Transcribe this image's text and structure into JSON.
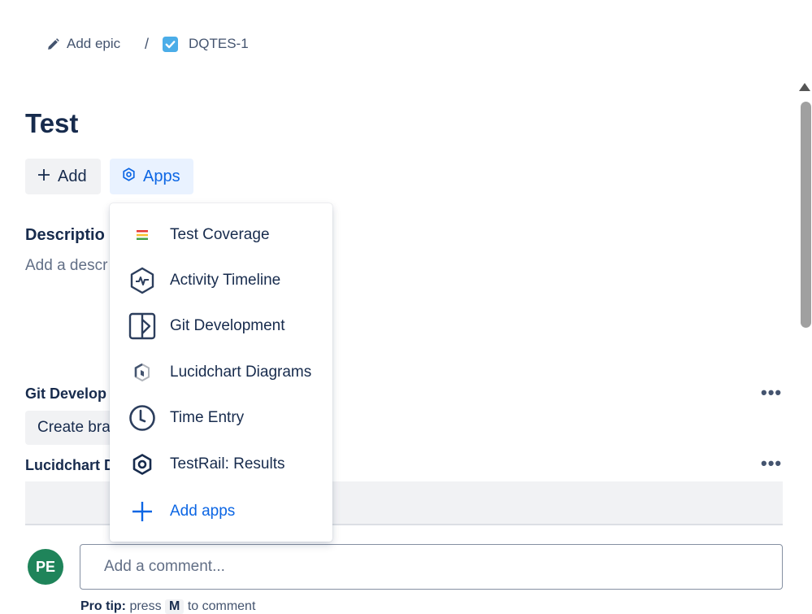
{
  "breadcrumb": {
    "epic_label": "Add epic",
    "separator": "/",
    "issue_key": "DQTES-1"
  },
  "issue": {
    "title": "Test"
  },
  "actions": {
    "add_label": "Add",
    "apps_label": "Apps"
  },
  "description": {
    "label": "Descriptio",
    "placeholder": "Add a descr"
  },
  "git_section": {
    "label": "Git Develop",
    "create_branch": "Create bra",
    "more": "•••"
  },
  "lucid_section": {
    "label": "Lucidchart D",
    "more": "•••"
  },
  "apps_menu": {
    "items": [
      {
        "label": "Test Coverage",
        "icon": "test-coverage-icon"
      },
      {
        "label": "Activity Timeline",
        "icon": "activity-timeline-icon"
      },
      {
        "label": "Git Development",
        "icon": "git-development-icon"
      },
      {
        "label": "Lucidchart Diagrams",
        "icon": "lucidchart-icon"
      },
      {
        "label": "Time Entry",
        "icon": "clock-icon"
      },
      {
        "label": "TestRail: Results",
        "icon": "testrail-icon"
      },
      {
        "label": "Add apps",
        "icon": "plus-icon"
      }
    ]
  },
  "comment": {
    "avatar_initials": "PE",
    "placeholder": "Add a comment...",
    "protip_prefix": "Pro tip:",
    "protip_press": "press",
    "protip_key": "M",
    "protip_suffix": "to comment"
  },
  "colors": {
    "accent": "#0c66e4",
    "avatar": "#1f845a",
    "text": "#172b4d"
  }
}
